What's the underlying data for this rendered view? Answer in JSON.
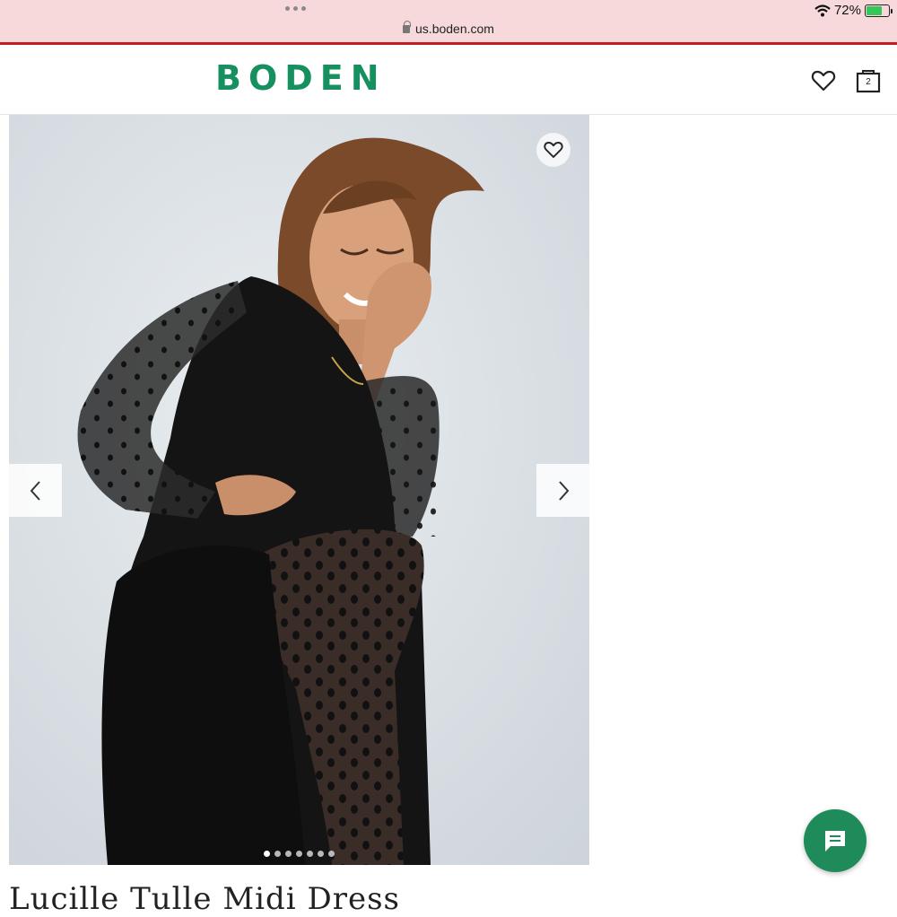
{
  "browser": {
    "url": "us.boden.com",
    "battery_percent": "72%"
  },
  "header": {
    "logo_text": "BODEN",
    "bag_count": "2",
    "brand_color": "#179060"
  },
  "gallery": {
    "image_count": 7,
    "active_index": 0,
    "icons": [
      "heart-icon",
      "chevron-left-icon",
      "chevron-right-icon"
    ]
  },
  "product": {
    "title": "Lucille Tulle Midi Dress"
  },
  "chat": {
    "icon": "chat-bubble-icon",
    "color": "#1f8b5a"
  }
}
